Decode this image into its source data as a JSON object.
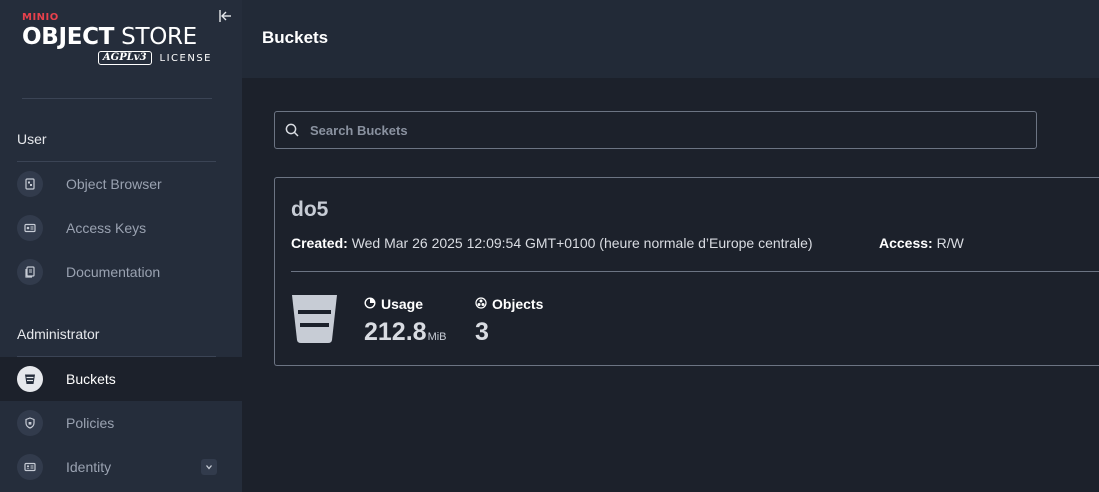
{
  "brand": {
    "vendor": "MINIO",
    "product_bold": "OBJECT",
    "product_rest": "STORE",
    "license_badge": "AGPLv3",
    "license_text": "LICENSE"
  },
  "sidebar": {
    "sections": [
      {
        "label": "User",
        "items": [
          {
            "label": "Object Browser",
            "icon": "object-browser-icon"
          },
          {
            "label": "Access Keys",
            "icon": "access-keys-icon"
          },
          {
            "label": "Documentation",
            "icon": "documentation-icon"
          }
        ]
      },
      {
        "label": "Administrator",
        "items": [
          {
            "label": "Buckets",
            "icon": "bucket-icon",
            "active": true
          },
          {
            "label": "Policies",
            "icon": "shield-icon"
          },
          {
            "label": "Identity",
            "icon": "identity-icon",
            "expandable": true
          }
        ]
      }
    ]
  },
  "header": {
    "title": "Buckets"
  },
  "search": {
    "placeholder": "Search Buckets",
    "value": ""
  },
  "bucket": {
    "name": "do5",
    "created_label": "Created:",
    "created_value": "Wed Mar 26 2025 12:09:54 GMT+0100 (heure normale d’Europe centrale)",
    "access_label": "Access:",
    "access_value": "R/W",
    "usage_label": "Usage",
    "usage_value": "212.8",
    "usage_unit": "MiB",
    "objects_label": "Objects",
    "objects_value": "3"
  },
  "colors": {
    "sidebar_bg": "#252d3b",
    "header_bg": "#222a37",
    "main_bg": "#1c212b",
    "brand_red": "#e8414c",
    "border": "#6c7483"
  }
}
